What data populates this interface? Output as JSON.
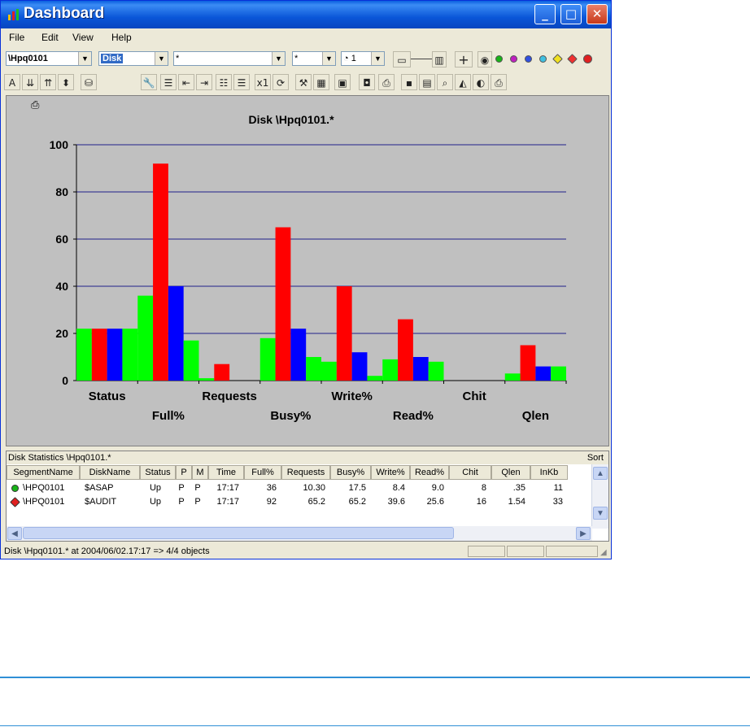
{
  "window": {
    "title": "Dashboard",
    "controls": {
      "minimize": "_",
      "maximize": "□",
      "close": "✕"
    }
  },
  "menu": [
    "File",
    "Edit",
    "View",
    "Help"
  ],
  "toolbar1": {
    "system_combo": "\\Hpq0101",
    "entity_combo": "Disk",
    "object_combo": "*",
    "filter_combo": "*",
    "interval_combo": "1",
    "status_dots": [
      "#c0c0c0",
      "#18b418",
      "#c020c0",
      "#3050e0",
      "#40c0e0",
      "#f0e020",
      "#f03030",
      "#e02020"
    ]
  },
  "toolbar2_icons": [
    "font-icon",
    "sort-asc-icon",
    "sort-desc-icon",
    "up-down-icon",
    "disk-icon",
    "wrench-icon",
    "list-icon",
    "indent-icon",
    "outdent-icon",
    "list2-icon",
    "list3-icon",
    "x1-icon",
    "refresh-icon",
    "hammer-icon",
    "grid-icon",
    "properties-icon",
    "camera-icon",
    "print-preview-icon",
    "save-icon",
    "table-icon",
    "binoculars-icon",
    "chart-icon",
    "pie-icon",
    "print-icon"
  ],
  "chart_data": {
    "type": "bar",
    "title": "Disk \\Hpq0101.*",
    "categories": [
      "Status",
      "Full%",
      "Requests",
      "Busy%",
      "Write%",
      "Read%",
      "Chit",
      "Qlen"
    ],
    "series": [
      {
        "color": "#00ff00",
        "values": [
          22,
          36,
          1,
          18,
          8,
          9,
          0,
          3
        ]
      },
      {
        "color": "#ff0000",
        "values": [
          22,
          92,
          7,
          65,
          40,
          26,
          0,
          15
        ]
      },
      {
        "color": "#0000ff",
        "values": [
          22,
          40,
          0,
          22,
          12,
          10,
          0,
          6
        ]
      },
      {
        "color": "#00ff00",
        "values": [
          22,
          17,
          0,
          10,
          2,
          8,
          0,
          6
        ]
      }
    ],
    "ylim": [
      0,
      100
    ],
    "yticks": [
      0,
      20,
      40,
      60,
      80,
      100
    ],
    "grid": true,
    "legend": "none"
  },
  "stats": {
    "caption": "Disk Statistics \\Hpq0101.*",
    "sort_label": "Sort",
    "columns": [
      "SegmentName",
      "DiskName",
      "Status",
      "P",
      "M",
      "Time",
      "Full%",
      "Requests",
      "Busy%",
      "Write%",
      "Read%",
      "Chit",
      "Qlen",
      "InKb"
    ],
    "rows": [
      {
        "icon": "green-status-icon",
        "cells": [
          "\\HPQ0101",
          "$ASAP",
          "Up",
          "P",
          "P",
          "17:17",
          "36",
          "10.30",
          "17.5",
          "8.4",
          "9.0",
          "8",
          ".35",
          "11"
        ]
      },
      {
        "icon": "red-diamond-status-icon",
        "cells": [
          "\\HPQ0101",
          "$AUDIT",
          "Up",
          "P",
          "P",
          "17:17",
          "92",
          "65.2",
          "65.2",
          "39.6",
          "25.6",
          "16",
          "1.54",
          "33"
        ]
      }
    ]
  },
  "status": {
    "text": "Disk \\Hpq0101.* at 2004/06/02.17:17 => 4/4 objects"
  }
}
